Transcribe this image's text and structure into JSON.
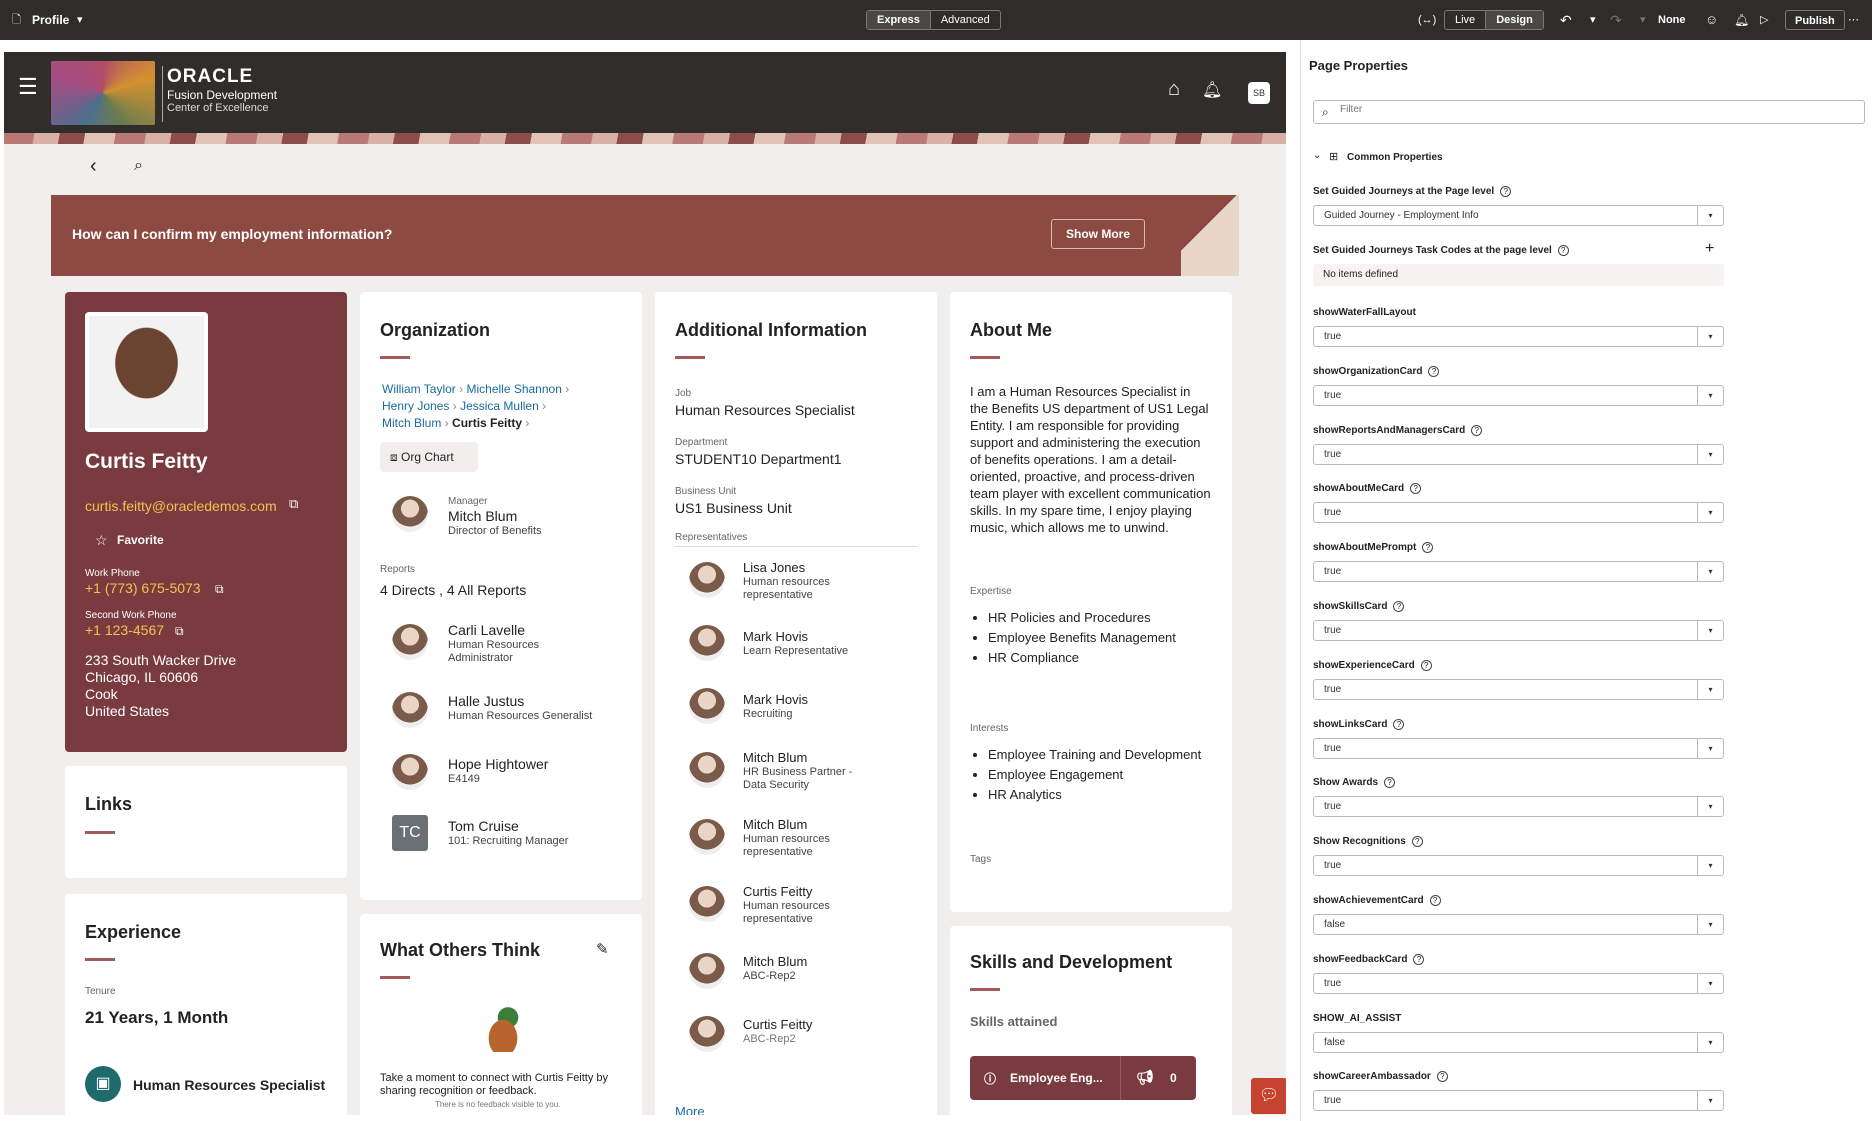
{
  "topbar": {
    "title": "Profile",
    "express": "Express",
    "advanced": "Advanced",
    "live": "Live",
    "design": "Design",
    "none": "None",
    "publish": "Publish"
  },
  "header": {
    "oracle": "ORACLE",
    "fusion": "Fusion Development",
    "coe": "Center of Excellence",
    "initials": "SB"
  },
  "banner": {
    "question": "How can I confirm my employment information?",
    "button": "Show More"
  },
  "profile": {
    "name": "Curtis Feitty",
    "email": "curtis.feitty@oracledemos.com",
    "favorite": "Favorite",
    "work_phone_label": "Work Phone",
    "work_phone": "+1 (773) 675-5073",
    "second_phone_label": "Second Work Phone",
    "second_phone": "+1 123-4567",
    "address": [
      "233 South Wacker Drive",
      "Chicago, IL 60606",
      "Cook",
      "United States"
    ]
  },
  "links": {
    "title": "Links"
  },
  "experience": {
    "title": "Experience",
    "tenure_label": "Tenure",
    "tenure": "21 Years, 1 Month",
    "job": "Human Resources Specialist"
  },
  "organization": {
    "title": "Organization",
    "breadcrumb": [
      "William Taylor",
      "Michelle Shannon",
      "Henry Jones",
      "Jessica Mullen",
      "Mitch Blum",
      "Curtis Feitty"
    ],
    "org_chart": "Org Chart",
    "manager_label": "Manager",
    "manager_name": "Mitch Blum",
    "manager_title": "Director of Benefits",
    "reports_label": "Reports",
    "reports_value": "4 Directs , 4 All Reports",
    "reports": [
      {
        "name": "Carli Lavelle",
        "title": "Human Resources Administrator"
      },
      {
        "name": "Halle Justus",
        "title": "Human Resources Generalist"
      },
      {
        "name": "Hope Hightower",
        "title": "E4149"
      },
      {
        "name": "Tom Cruise",
        "title": "101: Recruiting Manager",
        "initials": "TC"
      }
    ]
  },
  "what_others": {
    "title": "What Others Think",
    "prompt": "Take a moment to connect with Curtis Feitty by sharing recognition or feedback.",
    "note": "There is no feedback visible to you."
  },
  "additional": {
    "title": "Additional Information",
    "job_label": "Job",
    "job": "Human Resources Specialist",
    "dept_label": "Department",
    "dept": "STUDENT10 Department1",
    "bu_label": "Business Unit",
    "bu": "US1 Business Unit",
    "reps_label": "Representatives",
    "reps": [
      {
        "name": "Lisa Jones",
        "role": "Human resources representative"
      },
      {
        "name": "Mark Hovis",
        "role": "Learn Representative"
      },
      {
        "name": "Mark Hovis",
        "role": "Recruiting"
      },
      {
        "name": "Mitch Blum",
        "role": "HR Business Partner - Data Security"
      },
      {
        "name": "Mitch Blum",
        "role": "Human resources representative"
      },
      {
        "name": "Curtis Feitty",
        "role": "Human resources representative"
      },
      {
        "name": "Mitch Blum",
        "role": "ABC-Rep2"
      },
      {
        "name": "Curtis Feitty",
        "role": "ABC-Rep2"
      }
    ],
    "more": "More"
  },
  "about": {
    "title": "About Me",
    "text": "I am a Human Resources Specialist in the Benefits US department of US1 Legal Entity. I am responsible for providing support and administering the execution of benefits operations. I am a detail-oriented, proactive, and process-driven team player with excellent communication skills. In my spare time, I enjoy playing music, which allows me to unwind.",
    "expertise_label": "Expertise",
    "expertise": [
      "HR Policies and Procedures",
      "Employee Benefits Management",
      "HR Compliance"
    ],
    "interests_label": "Interests",
    "interests": [
      "Employee Training and Development",
      "Employee Engagement",
      "HR Analytics"
    ],
    "tags_label": "Tags"
  },
  "skills": {
    "title": "Skills and Development",
    "attained": "Skills attained",
    "chip": "Employee Eng...",
    "count": "0"
  },
  "panel": {
    "title": "Page Properties",
    "filter_placeholder": "Filter",
    "common": "Common Properties",
    "gj_label": "Set Guided Journeys at the Page level",
    "gj_value": "Guided Journey - Employment Info",
    "gjtc_label": "Set Guided Journeys Task Codes at the page level",
    "gjtc_value": "No items defined",
    "props": [
      {
        "label": "showWaterFallLayout",
        "value": "true",
        "help": false
      },
      {
        "label": "showOrganizationCard",
        "value": "true",
        "help": true
      },
      {
        "label": "showReportsAndManagersCard",
        "value": "true",
        "help": true
      },
      {
        "label": "showAboutMeCard",
        "value": "true",
        "help": true
      },
      {
        "label": "showAboutMePrompt",
        "value": "true",
        "help": true
      },
      {
        "label": "showSkillsCard",
        "value": "true",
        "help": true
      },
      {
        "label": "showExperienceCard",
        "value": "true",
        "help": true
      },
      {
        "label": "showLinksCard",
        "value": "true",
        "help": true
      },
      {
        "label": "Show Awards",
        "value": "true",
        "help": true
      },
      {
        "label": "Show Recognitions",
        "value": "true",
        "help": true
      },
      {
        "label": "showAchievementCard",
        "value": "false",
        "help": true
      },
      {
        "label": "showFeedbackCard",
        "value": "true",
        "help": true
      },
      {
        "label": "SHOW_AI_ASSIST",
        "value": "false",
        "help": false
      },
      {
        "label": "showCareerAmbassador",
        "value": "true",
        "help": true
      }
    ]
  },
  "colors": {
    "accent": "#8d4a43",
    "topbar": "#2f2d2b",
    "link": "#1a6a9c"
  }
}
